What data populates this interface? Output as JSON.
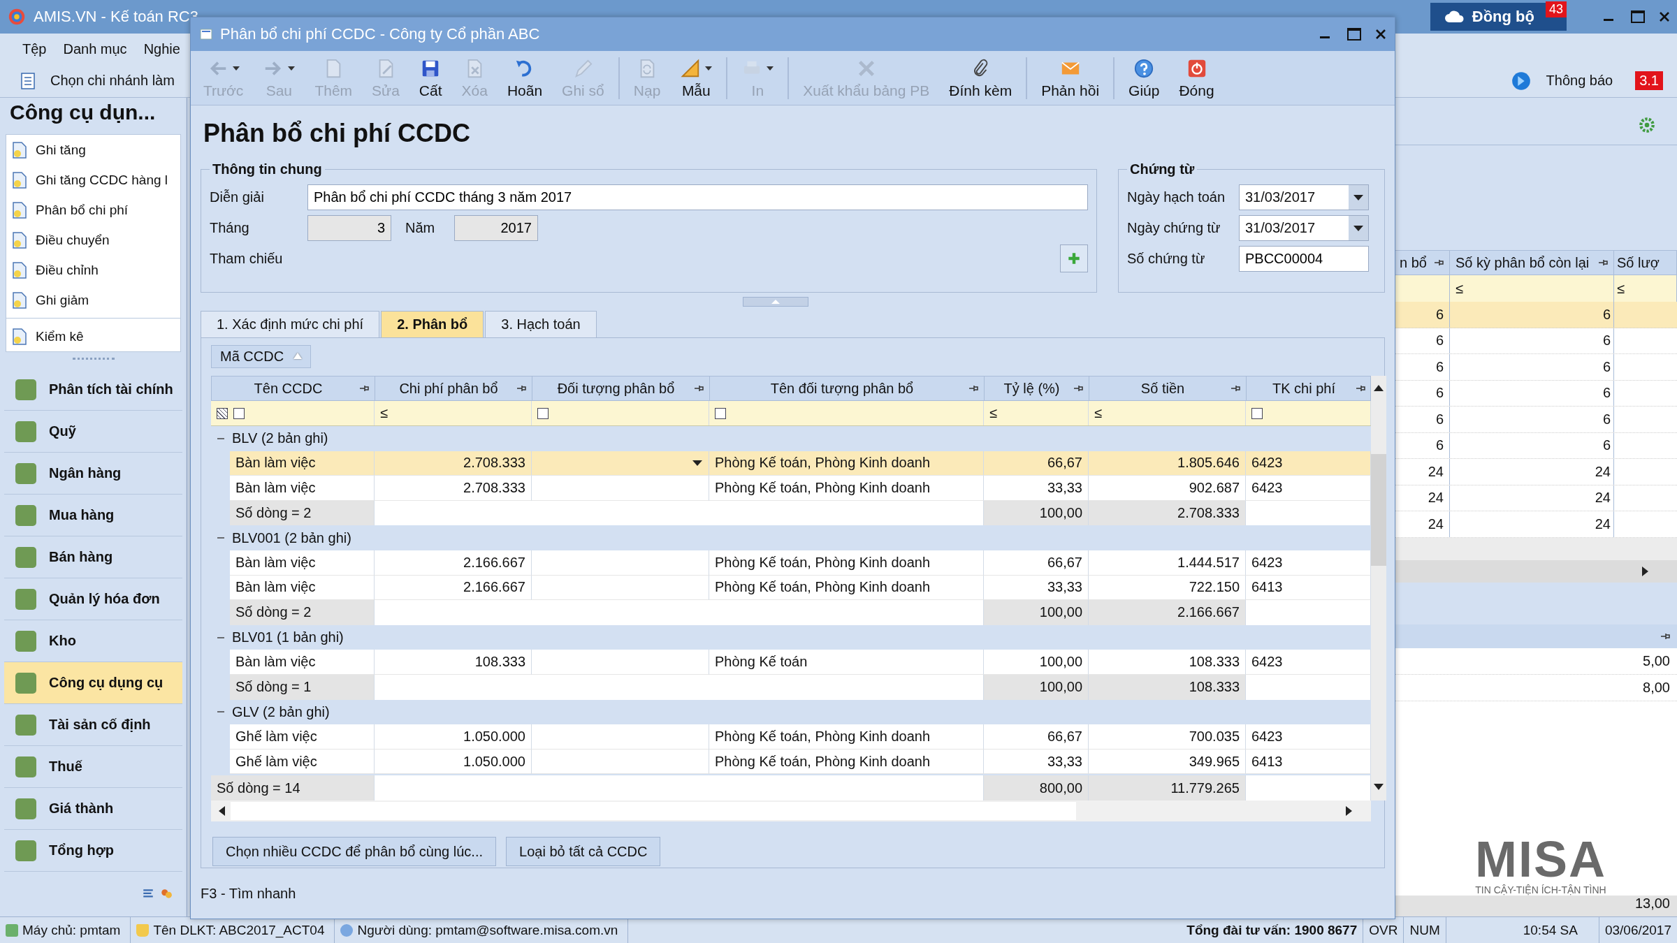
{
  "app": {
    "title": "AMIS.VN - Kế toán RC3",
    "menu": [
      "Tệp",
      "Danh mục",
      "Nghie"
    ],
    "branch_prompt": "Chọn chi nhánh làm",
    "sync": {
      "label": "Đồng bộ",
      "badge": "43"
    },
    "notification": {
      "label": "Thông báo",
      "badge": "3.1"
    }
  },
  "sidebar": {
    "title": "Công cụ dụn...",
    "items": [
      "Ghi tăng",
      "Ghi tăng CCDC hàng l",
      "Phân bổ chi phí",
      "Điều chuyển",
      "Điều chỉnh",
      "Ghi giảm"
    ],
    "extra_items": [
      "Kiểm kê"
    ],
    "modules": [
      {
        "label": "Phân tích tài chính",
        "selected": false
      },
      {
        "label": "Quỹ",
        "selected": false
      },
      {
        "label": "Ngân hàng",
        "selected": false
      },
      {
        "label": "Mua hàng",
        "selected": false
      },
      {
        "label": "Bán hàng",
        "selected": false
      },
      {
        "label": "Quản lý hóa đơn",
        "selected": false
      },
      {
        "label": "Kho",
        "selected": false
      },
      {
        "label": "Công cụ dụng cụ",
        "selected": true
      },
      {
        "label": "Tài sản cố định",
        "selected": false
      },
      {
        "label": "Thuế",
        "selected": false
      },
      {
        "label": "Giá thành",
        "selected": false
      },
      {
        "label": "Tổng hợp",
        "selected": false
      }
    ]
  },
  "side_grid": {
    "columns": [
      {
        "label": "n bổ"
      },
      {
        "label": "Số kỳ phân bổ còn lại",
        "filter": "≤"
      },
      {
        "label": "Số lượ",
        "filter": "≤"
      }
    ],
    "rows": [
      {
        "cells": [
          "6",
          "6"
        ],
        "selected": true
      },
      {
        "cells": [
          "6",
          "6"
        ],
        "selected": false
      },
      {
        "cells": [
          "6",
          "6"
        ],
        "selected": false
      },
      {
        "cells": [
          "6",
          "6"
        ],
        "selected": false
      },
      {
        "cells": [
          "6",
          "6"
        ],
        "selected": false
      },
      {
        "cells": [
          "6",
          "6"
        ],
        "selected": false
      },
      {
        "cells": [
          "24",
          "24"
        ],
        "selected": false
      },
      {
        "cells": [
          "24",
          "24"
        ],
        "selected": false
      },
      {
        "cells": [
          "24",
          "24"
        ],
        "selected": false
      }
    ]
  },
  "lower_panel": {
    "values": [
      "5,00",
      "8,00"
    ],
    "total": "13,00"
  },
  "logo": {
    "name": "MISA",
    "tagline": "TIN CẬY-TIỆN ÍCH-TẬN TÌNH"
  },
  "dialog": {
    "title": "Phân bổ chi phí CCDC - Công ty Cổ phần ABC",
    "toolbar": [
      {
        "label": "Trước",
        "kind": "back",
        "disabled": true,
        "dropdown": true,
        "separator_before": false
      },
      {
        "label": "Sau",
        "kind": "forward",
        "disabled": true,
        "dropdown": true,
        "separator_before": false
      },
      {
        "label": "Thêm",
        "kind": "add",
        "disabled": true,
        "dropdown": false,
        "separator_before": false
      },
      {
        "label": "Sửa",
        "kind": "edit",
        "disabled": true,
        "dropdown": false,
        "separator_before": false
      },
      {
        "label": "Cất",
        "kind": "save",
        "disabled": false,
        "dropdown": false,
        "separator_before": false
      },
      {
        "label": "Xóa",
        "kind": "delete",
        "disabled": true,
        "dropdown": false,
        "separator_before": false
      },
      {
        "label": "Hoãn",
        "kind": "undo",
        "disabled": false,
        "dropdown": false,
        "separator_before": false
      },
      {
        "label": "Ghi sổ",
        "kind": "post",
        "disabled": true,
        "dropdown": false,
        "separator_before": false
      },
      {
        "label": "Nạp",
        "kind": "reload",
        "disabled": true,
        "dropdown": false,
        "separator_before": true
      },
      {
        "label": "Mẫu",
        "kind": "template",
        "disabled": false,
        "dropdown": true,
        "separator_before": false
      },
      {
        "label": "In",
        "kind": "print",
        "disabled": true,
        "dropdown": true,
        "separator_before": true
      },
      {
        "label": "Xuất khẩu bảng PB",
        "kind": "export",
        "disabled": true,
        "dropdown": false,
        "separator_before": true
      },
      {
        "label": "Đính kèm",
        "kind": "attach",
        "disabled": false,
        "dropdown": false,
        "separator_before": false
      },
      {
        "label": "Phản hồi",
        "kind": "feedback",
        "disabled": false,
        "dropdown": false,
        "separator_before": true
      },
      {
        "label": "Giúp",
        "kind": "help",
        "disabled": false,
        "dropdown": false,
        "separator_before": true
      },
      {
        "label": "Đóng",
        "kind": "close",
        "disabled": false,
        "dropdown": false,
        "separator_before": false
      }
    ],
    "heading": "Phân bổ chi phí CCDC",
    "general": {
      "title": "Thông tin chung",
      "description": {
        "label": "Diễn giải",
        "value": "Phân bổ chi phí CCDC tháng 3 năm 2017"
      },
      "month": {
        "label": "Tháng",
        "value": "3"
      },
      "year": {
        "label": "Năm",
        "value": "2017"
      },
      "reference": {
        "label": "Tham chiếu"
      }
    },
    "voucher": {
      "title": "Chứng từ",
      "fields": [
        {
          "label": "Ngày hạch toán",
          "value": "31/03/2017",
          "dropdown": true
        },
        {
          "label": "Ngày chứng từ",
          "value": "31/03/2017",
          "dropdown": true
        },
        {
          "label": "Số chứng từ",
          "value": "PBCC00004",
          "dropdown": false
        }
      ]
    },
    "tabs": [
      {
        "label": "1. Xác định mức chi phí",
        "selected": false
      },
      {
        "label": "2. Phân bổ",
        "selected": true
      },
      {
        "label": "3. Hạch toán",
        "selected": false
      }
    ],
    "group_by": {
      "label": "Mã CCDC"
    },
    "grid": {
      "columns": [
        {
          "label": "Tên CCDC",
          "filter": {
            "kind": "select"
          }
        },
        {
          "label": "Chi phí phân bổ",
          "filter": {
            "kind": "compare",
            "symbol": "≤"
          }
        },
        {
          "label": "Đối tượng phân bổ",
          "filter": {
            "kind": "select"
          }
        },
        {
          "label": "Tên đối tượng phân bổ",
          "filter": {
            "kind": "select"
          }
        },
        {
          "label": "Tỷ lệ (%)",
          "filter": {
            "kind": "compare",
            "symbol": "≤"
          }
        },
        {
          "label": "Số tiền",
          "filter": {
            "kind": "compare",
            "symbol": "≤"
          }
        },
        {
          "label": "TK chi phí",
          "filter": {
            "kind": "select"
          }
        }
      ],
      "groups": [
        {
          "label": "BLV (2 bản ghi)",
          "expanded": true,
          "rows": [
            {
              "name": "Bàn làm việc",
              "cost": "2.708.333",
              "target_name": "Phòng Kế toán, Phòng Kinh doanh",
              "rate": "66,67",
              "amount": "1.805.646",
              "account": "6423",
              "selected": true,
              "editing": true
            },
            {
              "name": "Bàn làm việc",
              "cost": "2.708.333",
              "target_name": "Phòng Kế toán, Phòng Kinh doanh",
              "rate": "33,33",
              "amount": "902.687",
              "account": "6423",
              "selected": false,
              "editing": false
            }
          ],
          "summary": {
            "count": "Số dòng = 2",
            "rate": "100,00",
            "amount": "2.708.333"
          }
        },
        {
          "label": "BLV001 (2 bản ghi)",
          "expanded": true,
          "rows": [
            {
              "name": "Bàn làm việc",
              "cost": "2.166.667",
              "target_name": "Phòng Kế toán, Phòng Kinh doanh",
              "rate": "66,67",
              "amount": "1.444.517",
              "account": "6423",
              "selected": false,
              "editing": false
            },
            {
              "name": "Bàn làm việc",
              "cost": "2.166.667",
              "target_name": "Phòng Kế toán, Phòng Kinh doanh",
              "rate": "33,33",
              "amount": "722.150",
              "account": "6413",
              "selected": false,
              "editing": false
            }
          ],
          "summary": {
            "count": "Số dòng = 2",
            "rate": "100,00",
            "amount": "2.166.667"
          }
        },
        {
          "label": "BLV01 (1 bản ghi)",
          "expanded": true,
          "rows": [
            {
              "name": "Bàn làm việc",
              "cost": "108.333",
              "target_name": "Phòng Kế toán",
              "rate": "100,00",
              "amount": "108.333",
              "account": "6423",
              "selected": false,
              "editing": false
            }
          ],
          "summary": {
            "count": "Số dòng = 1",
            "rate": "100,00",
            "amount": "108.333"
          }
        },
        {
          "label": "GLV (2 bản ghi)",
          "expanded": true,
          "rows": [
            {
              "name": "Ghế làm việc",
              "cost": "1.050.000",
              "target_name": "Phòng Kế toán, Phòng Kinh doanh",
              "rate": "66,67",
              "amount": "700.035",
              "account": "6423",
              "selected": false,
              "editing": false
            },
            {
              "name": "Ghế làm việc",
              "cost": "1.050.000",
              "target_name": "Phòng Kế toán, Phòng Kinh doanh",
              "rate": "33,33",
              "amount": "349.965",
              "account": "6413",
              "selected": false,
              "editing": false
            }
          ]
        }
      ],
      "total": {
        "count": "Số dòng = 14",
        "rate": "800,00",
        "amount": "11.779.265"
      }
    },
    "buttons": [
      "Chọn nhiều CCDC để phân bổ cùng lúc...",
      "Loại bỏ tất cả CCDC"
    ],
    "status": "F3 - Tìm nhanh"
  },
  "status_bar": {
    "items": [
      {
        "label": "Máy chủ: pmtam",
        "kind": "server"
      },
      {
        "label": "Tên DLKT: ABC2017_ACT04",
        "kind": "database"
      },
      {
        "label": "Người dùng: pmtam@software.misa.com.vn",
        "kind": "user"
      }
    ],
    "hotline": "Tổng đài tư vấn: 1900 8677",
    "indicators": [
      "OVR",
      "NUM"
    ],
    "time": "10:54 SA",
    "date": "03/06/2017"
  }
}
